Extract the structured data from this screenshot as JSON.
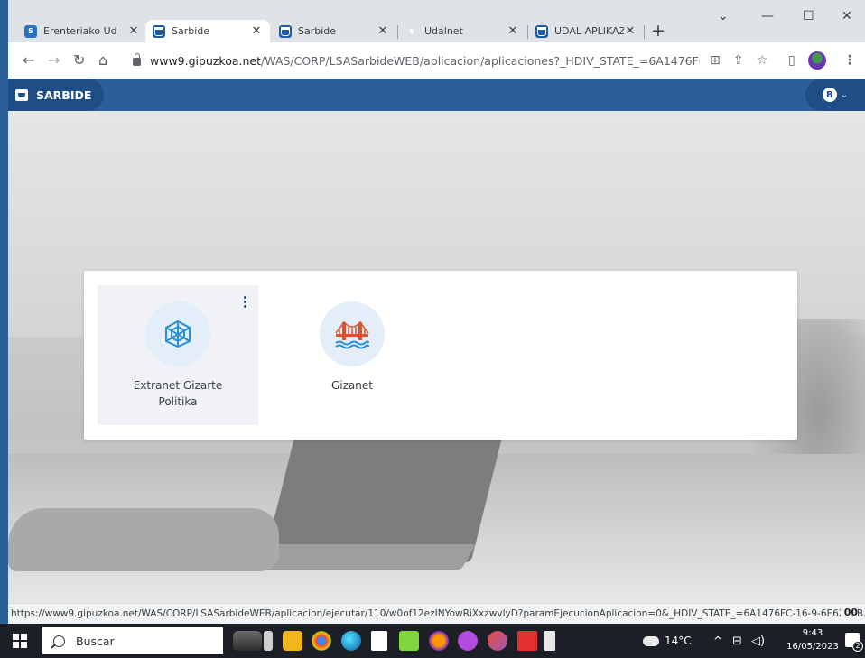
{
  "browser": {
    "tabs": [
      {
        "label": "Erenteriako Ud",
        "favicon": "s-icon",
        "active": false
      },
      {
        "label": "Sarbide",
        "favicon": "sarbide-icon",
        "active": true
      },
      {
        "label": "Sarbide",
        "favicon": "sarbide-icon",
        "active": false
      },
      {
        "label": "Udalnet",
        "favicon": "udalnet-icon",
        "active": false
      },
      {
        "label": "UDAL APLIKAZI",
        "favicon": "sarbide-icon",
        "active": false
      }
    ],
    "new_tab_label": "+",
    "url_host": "www9.gipuzkoa.net",
    "url_path": "/WAS/CORP/LSASarbideWEB/aplicacion/aplicaciones?_HDIV_STATE_=6A1476FC..."
  },
  "app": {
    "brand": "SARBIDE",
    "user_initial": "B"
  },
  "apps": [
    {
      "label": "Extranet Gizarte Politika",
      "icon": "network-web-icon",
      "selected": true
    },
    {
      "label": "Gizanet",
      "icon": "bridge-icon",
      "selected": false
    }
  ],
  "status_url": "https://www9.gipuzkoa.net/WAS/CORP/LSASarbideWEB/aplicacion/ejecutar/110/w0of12ezINYowRiXxzwvlyD?paramEjecucionAplicacion=0&_HDIV_STATE_=6A1476FC-16-9-6E62CFB...",
  "status_extra": "00",
  "taskbar": {
    "search_placeholder": "Buscar",
    "weather": "14°C",
    "time": "9:43",
    "date": "16/05/2023",
    "notification_count": "2"
  },
  "colors": {
    "header_blue": "#2b5f98",
    "header_dark": "#1f4e86",
    "app_icon_blue": "#2a8fd4",
    "bridge_red": "#d9542b",
    "bridge_water": "#2a8fd4"
  }
}
